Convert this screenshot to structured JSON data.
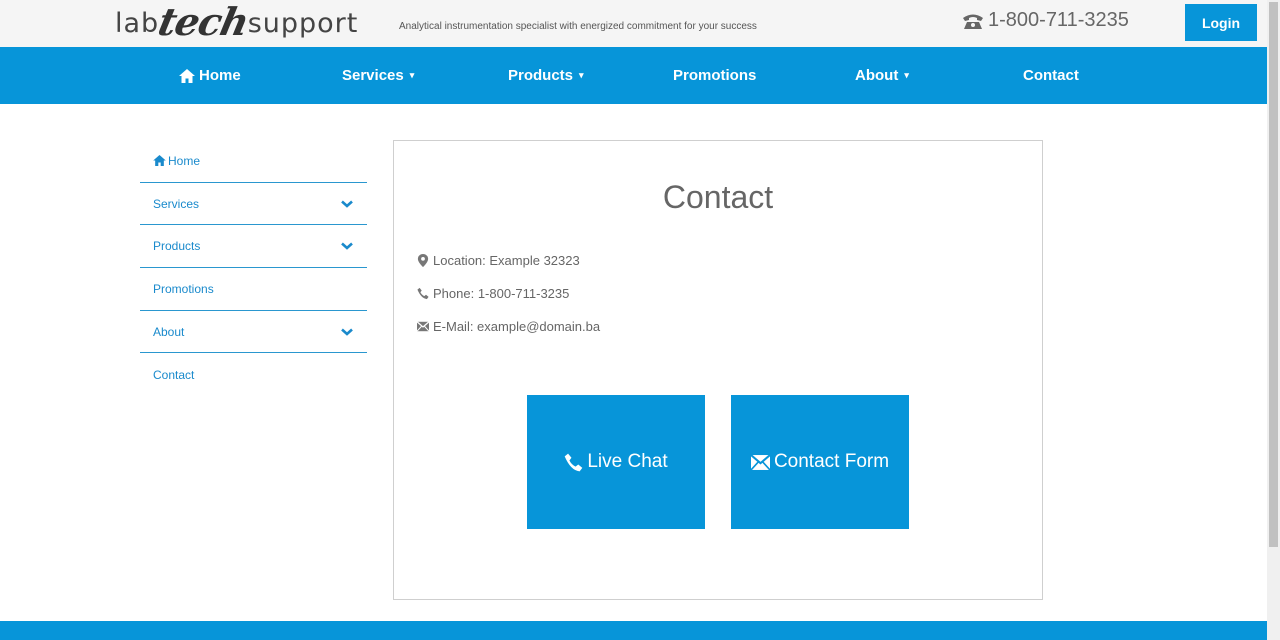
{
  "header": {
    "logo": {
      "lab": "lab",
      "tech": "tech",
      "support": "support"
    },
    "tagline": "Analytical instrumentation specialist with energized commitment for your success",
    "phone": "1-800-711-3235",
    "login_label": "Login"
  },
  "nav": {
    "items": [
      {
        "label": "Home",
        "icon": "home-icon"
      },
      {
        "label": "Services",
        "dropdown": true
      },
      {
        "label": "Products",
        "dropdown": true
      },
      {
        "label": "Promotions"
      },
      {
        "label": "About",
        "dropdown": true
      },
      {
        "label": "Contact"
      }
    ],
    "caret": "▾"
  },
  "sidebar": {
    "items": [
      {
        "label": "Home",
        "icon": "home-icon"
      },
      {
        "label": "Services",
        "expandable": true
      },
      {
        "label": "Products",
        "expandable": true
      },
      {
        "label": "Promotions"
      },
      {
        "label": "About",
        "expandable": true
      },
      {
        "label": "Contact"
      }
    ]
  },
  "content": {
    "title": "Contact",
    "location": "Location: Example 32323",
    "phone": "Phone: 1-800-711-3235",
    "email": "E-Mail: example@domain.ba",
    "live_chat_label": "Live Chat",
    "contact_form_label": "Contact Form"
  },
  "colors": {
    "accent": "#0795d9",
    "sidebar_text": "#1a8acc",
    "body_text": "#666666"
  }
}
